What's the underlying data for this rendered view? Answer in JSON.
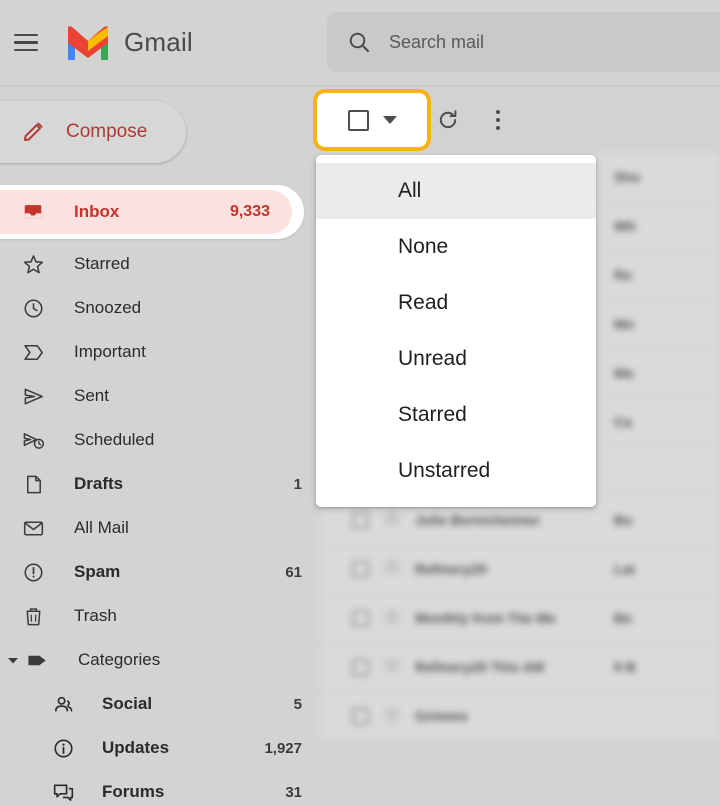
{
  "header": {
    "menu_icon": "hamburger-menu-icon",
    "logo_icon": "gmail-logo-icon",
    "wordmark": "Gmail"
  },
  "search": {
    "icon": "search-icon",
    "placeholder": "Search mail",
    "value": ""
  },
  "sidebar": {
    "compose": {
      "label": "Compose",
      "icon": "pencil-icon"
    },
    "items": [
      {
        "label": "Inbox",
        "count": "9,333",
        "icon": "inbox-icon",
        "selected": true,
        "bold": true
      },
      {
        "label": "Starred",
        "count": "",
        "icon": "star-icon",
        "selected": false,
        "bold": false
      },
      {
        "label": "Snoozed",
        "count": "",
        "icon": "clock-icon",
        "selected": false,
        "bold": false
      },
      {
        "label": "Important",
        "count": "",
        "icon": "important-icon",
        "selected": false,
        "bold": false
      },
      {
        "label": "Sent",
        "count": "",
        "icon": "send-icon",
        "selected": false,
        "bold": false
      },
      {
        "label": "Scheduled",
        "count": "",
        "icon": "scheduled-icon",
        "selected": false,
        "bold": false
      },
      {
        "label": "Drafts",
        "count": "1",
        "icon": "draft-icon",
        "selected": false,
        "bold": true
      },
      {
        "label": "All Mail",
        "count": "",
        "icon": "envelope-icon",
        "selected": false,
        "bold": false
      },
      {
        "label": "Spam",
        "count": "61",
        "icon": "spam-icon",
        "selected": false,
        "bold": true
      },
      {
        "label": "Trash",
        "count": "",
        "icon": "trash-icon",
        "selected": false,
        "bold": false
      }
    ],
    "categories": {
      "label": "Categories",
      "icon": "label-tag-icon",
      "caret_icon": "caret-down-icon",
      "expanded": true,
      "children": [
        {
          "label": "Social",
          "count": "5",
          "icon": "people-icon",
          "bold": true
        },
        {
          "label": "Updates",
          "count": "1,927",
          "icon": "info-icon",
          "bold": true
        },
        {
          "label": "Forums",
          "count": "31",
          "icon": "forums-icon",
          "bold": true
        }
      ]
    }
  },
  "toolbar": {
    "select_all": {
      "name": "select-all-dropdown",
      "checkbox_icon": "checkbox-empty-icon",
      "caret_icon": "caret-down-icon",
      "highlighted": true,
      "highlight_color": "#f6b319"
    },
    "refresh": {
      "label": "Refresh",
      "icon": "refresh-icon"
    },
    "more": {
      "label": "More options",
      "icon": "more-vertical-icon"
    }
  },
  "select_menu": {
    "open": true,
    "active_index": 0,
    "items": [
      {
        "label": "All"
      },
      {
        "label": "None"
      },
      {
        "label": "Read"
      },
      {
        "label": "Unread"
      },
      {
        "label": "Starred"
      },
      {
        "label": "Unstarred"
      }
    ]
  },
  "email_list": {
    "rows": [
      {
        "sender": "",
        "subject": "",
        "unread": true
      },
      {
        "sender": "",
        "subject": "",
        "unread": true
      },
      {
        "sender": "",
        "subject": "",
        "unread": true
      },
      {
        "sender": "",
        "subject": "",
        "unread": true
      },
      {
        "sender": "",
        "subject": "",
        "unread": true
      },
      {
        "sender": "",
        "subject": "",
        "unread": true
      },
      {
        "sender": "",
        "subject": "",
        "unread": true
      },
      {
        "sender": "",
        "subject": "",
        "unread": true
      },
      {
        "sender": "",
        "subject": "",
        "unread": true
      },
      {
        "sender": "",
        "subject": "",
        "unread": true
      },
      {
        "sender": "",
        "subject": "",
        "unread": true
      },
      {
        "sender": "",
        "subject": "",
        "unread": true
      },
      {
        "sender": "",
        "subject": "",
        "unread": true
      }
    ]
  },
  "colors": {
    "page_background": "#d2d2d2",
    "panel_background": "#d3d3d3",
    "gmail_red": "#c5342a",
    "inbox_pill": "#fbe2e0",
    "highlight_amber": "#f6b319",
    "menu_hover": "#ebebeb"
  }
}
